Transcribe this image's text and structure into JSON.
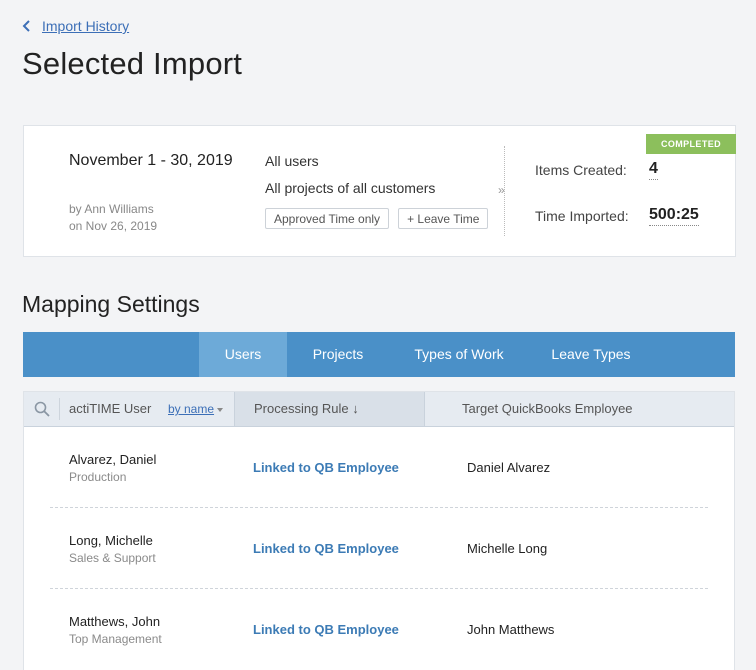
{
  "nav": {
    "back_label": "Import History"
  },
  "page": {
    "title": "Selected Import"
  },
  "import": {
    "status": "COMPLETED",
    "period": "November 1 - 30, 2019",
    "by_line": "by Ann Williams",
    "date_line": "on Nov 26, 2019",
    "users_filter": "All users",
    "projects_filter": "All projects of all customers",
    "chip_approved": "Approved Time only",
    "chip_leave": "+ Leave Time",
    "items_created_label": "Items Created:",
    "items_created_value": "4",
    "time_imported_label": "Time Imported:",
    "time_imported_value": "500:25"
  },
  "mapping": {
    "title": "Mapping Settings",
    "tabs": [
      "Users",
      "Projects",
      "Types of Work",
      "Leave Types"
    ],
    "active_tab": "Users",
    "columns": {
      "user": "actiTIME User",
      "sort": "by name",
      "rule": "Processing Rule ↓",
      "target": "Target QuickBooks Employee"
    },
    "rows": [
      {
        "name": "Alvarez, Daniel",
        "dept": "Production",
        "rule": "Linked to QB Employee",
        "qb": "Daniel Alvarez"
      },
      {
        "name": "Long, Michelle",
        "dept": "Sales & Support",
        "rule": "Linked to QB Employee",
        "qb": "Michelle Long"
      },
      {
        "name": "Matthews, John",
        "dept": "Top Management",
        "rule": "Linked to QB Employee",
        "qb": "John Matthews"
      }
    ]
  },
  "colors": {
    "accent": "#4a90c8",
    "active_tab": "#6daad8",
    "badge": "#8cbf5c",
    "link": "#3c6fb7"
  }
}
